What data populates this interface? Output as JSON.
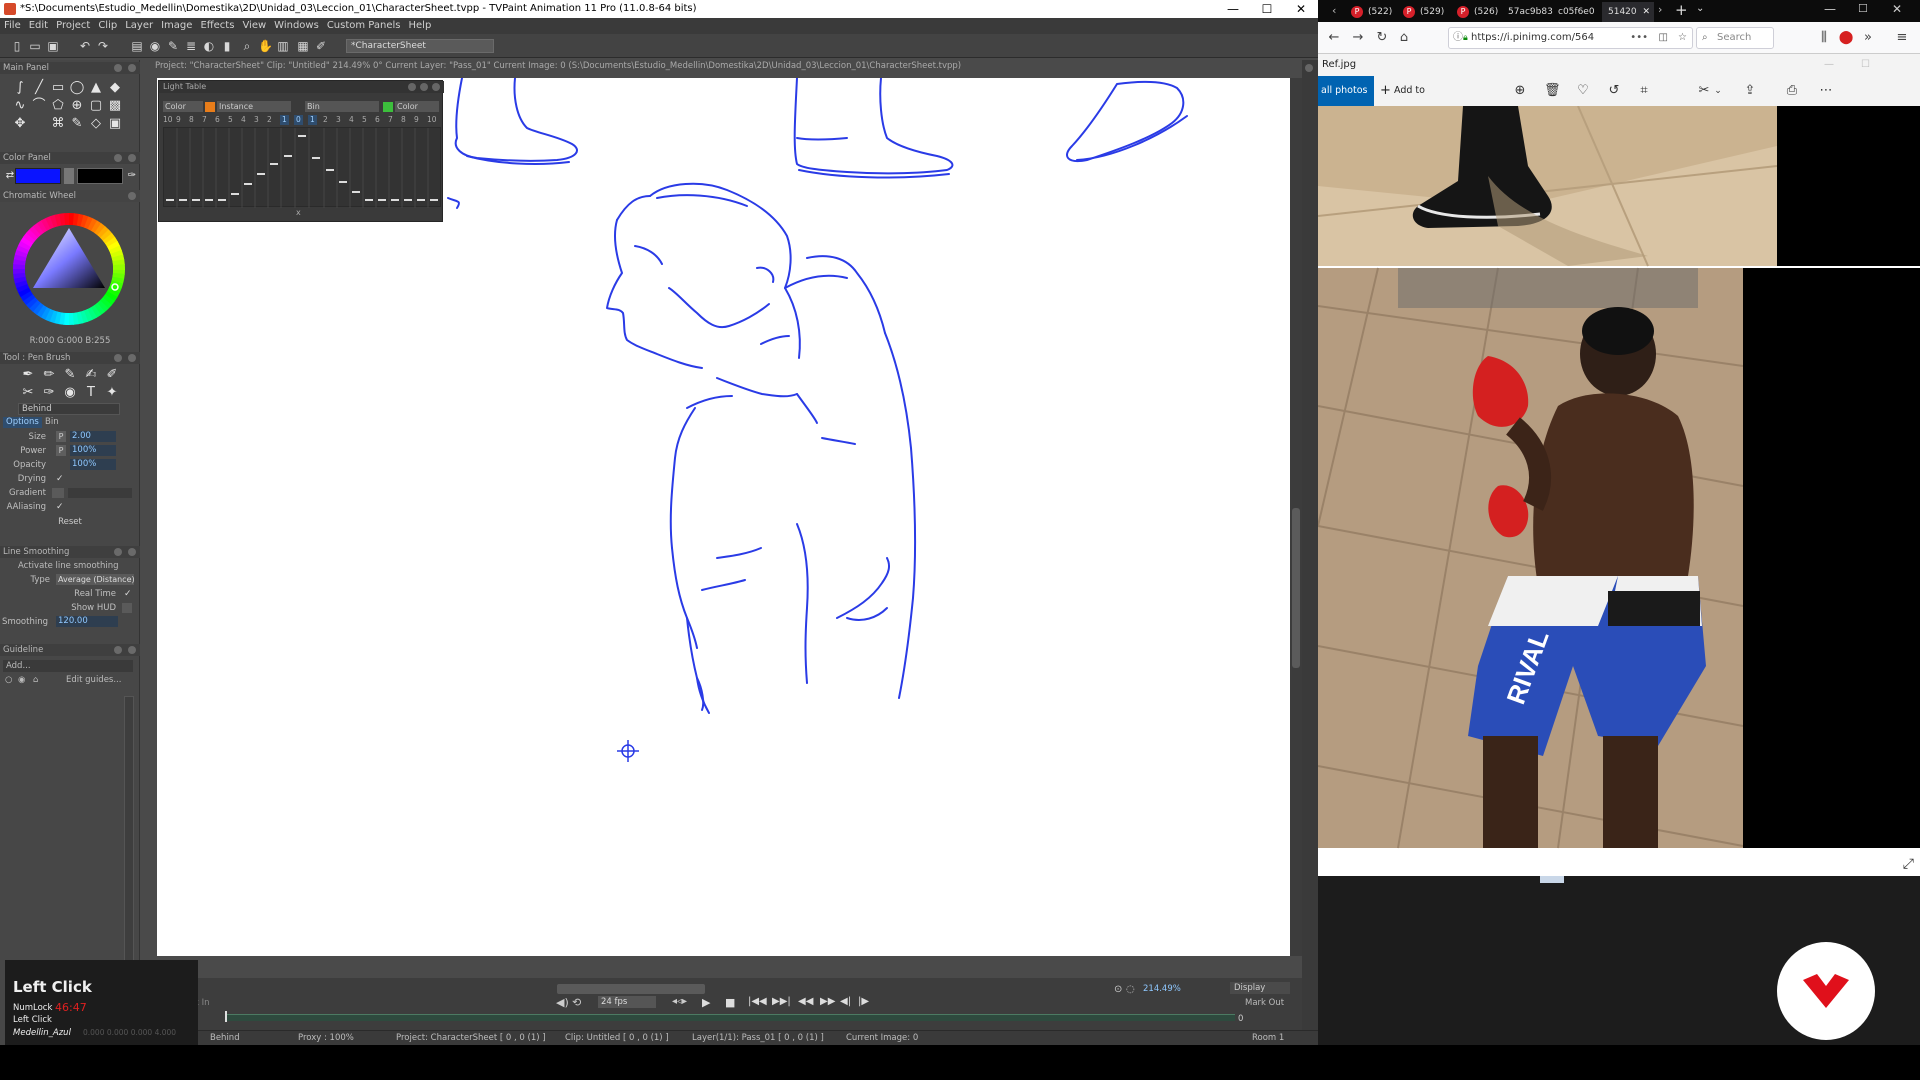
{
  "tvpaint": {
    "title": "*S:\\Documents\\Estudio_Medellin\\Domestika\\2D\\Unidad_03\\Leccion_01\\CharacterSheet.tvpp - TVPaint Animation 11 Pro (11.0.8-64 bits)",
    "window_buttons": [
      "—",
      "☐",
      "✕"
    ],
    "menu": [
      "File",
      "Edit",
      "Project",
      "Clip",
      "Layer",
      "Image",
      "Effects",
      "View",
      "Windows",
      "Custom Panels",
      "Help"
    ],
    "project_tab": "*CharacterSheet",
    "info_bar": "Project: \"CharacterSheet\"  Clip: \"Untitled\"   214.49%   0°  Current Layer: \"Pass_01\"  Current Image: 0 (S:\\Documents\\Estudio_Medellin\\Domestika\\2D\\Unidad_03\\Leccion_01\\CharacterSheet.tvpp)",
    "main_panel": {
      "title": "Main Panel"
    },
    "color_panel": {
      "title": "Color Panel",
      "fg_color": "#0a14ff",
      "bg_color": "#000000",
      "chromatic_title": "Chromatic Wheel",
      "rgb_readout": "R:000 G:000 B:255"
    },
    "tool_panel": {
      "title": "Tool : Pen Brush",
      "mode": "Behind",
      "tabs": [
        "Options",
        "Bin"
      ],
      "options": [
        {
          "label": "Size",
          "value": "2.00",
          "prefix": "P"
        },
        {
          "label": "Power",
          "value": "100%",
          "prefix": "P"
        },
        {
          "label": "Opacity",
          "value": "100%",
          "prefix": ""
        },
        {
          "label": "Drying",
          "value": "",
          "check": "✓"
        },
        {
          "label": "Gradient",
          "value": "",
          "check": ""
        },
        {
          "label": "AAliasing",
          "value": "",
          "check": "✓"
        }
      ],
      "reset": "Reset"
    },
    "line_smoothing": {
      "title": "Line Smoothing",
      "activate": "Activate line smoothing",
      "type_label": "Type",
      "type_value": "Average (Distance)",
      "realtime_label": "Real Time",
      "showhud_label": "Show HUD",
      "smoothing_label": "Smoothing",
      "smoothing_value": "120.00",
      "check": "✓"
    },
    "guideline": {
      "title": "Guideline",
      "add": "Add...",
      "edit": "Edit guides..."
    },
    "light_table": {
      "title": "Light Table",
      "chips": [
        "Color",
        "Instance",
        "Bin",
        "Color"
      ],
      "chip_color_1": "#e87d1a",
      "chip_color_2": "#3cbf3c",
      "numbers": [
        "10",
        "9",
        "8",
        "7",
        "6",
        "5",
        "4",
        "3",
        "2",
        "1",
        "0",
        "1",
        "2",
        "3",
        "4",
        "5",
        "6",
        "7",
        "8",
        "9",
        "10"
      ],
      "x_label": "x"
    },
    "timeline": {
      "mark_in": "Mark In",
      "mark_out": "Mark Out",
      "fps": "24 fps",
      "zoom": "214.49%",
      "display": "Display",
      "frame_zero": "0"
    },
    "status": {
      "mode": "Behind",
      "proxy": "Proxy : 100%",
      "project": "Project: CharacterSheet [ 0 , 0  (1) ]",
      "clip": "Clip: Untitled [ 0 , 0  (1) ]",
      "layer": "Layer(1/1): Pass_01 [ 0 , 0  (1) ]",
      "current_image": "Current Image: 0",
      "room": "Room 1"
    },
    "click_overlay": {
      "action": "Left Click",
      "numlock": "NumLock",
      "time": "46:47",
      "last": "Left Click",
      "brush": "Medellin_Azul",
      "faded": "0.000  0.000  0.000  4.000"
    }
  },
  "firefox": {
    "tabs": [
      {
        "label": "(522)",
        "pinned": true
      },
      {
        "label": "(529)",
        "pinned": true
      },
      {
        "label": "(526)",
        "pinned": true
      },
      {
        "label": "57ac9b83",
        "pinned": false
      },
      {
        "label": "c05f6e0",
        "pinned": false
      },
      {
        "label": "51420",
        "pinned": false
      }
    ],
    "url": "https://i.pinimg.com/564",
    "search_placeholder": "Search"
  },
  "photos": {
    "title": "Ref.jpg",
    "all_photos": "all photos",
    "add_to": "Add to",
    "shorts_text": "RIVAL"
  },
  "accent": {
    "stroke": "#2a3be6",
    "logo": "#e0101b"
  }
}
